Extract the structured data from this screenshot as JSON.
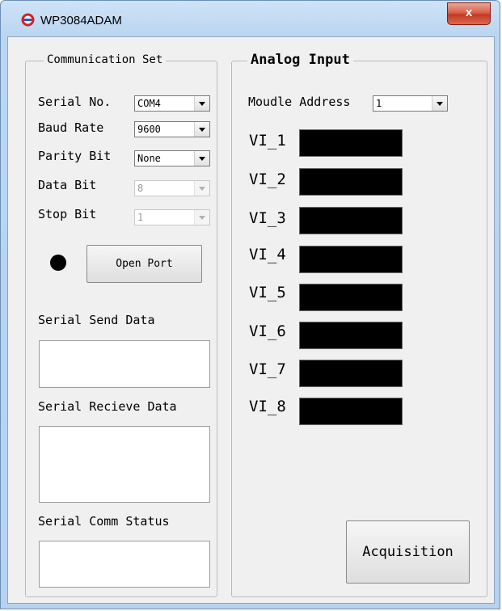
{
  "window": {
    "title": "WP3084ADAM",
    "close_label": "x"
  },
  "comm_group": {
    "legend": "Communication Set",
    "serial_no_label": "Serial No.",
    "serial_no_value": "COM4",
    "baud_rate_label": "Baud Rate",
    "baud_rate_value": "9600",
    "parity_bit_label": "Parity Bit",
    "parity_bit_value": "None",
    "data_bit_label": "Data Bit",
    "data_bit_value": "8",
    "stop_bit_label": "Stop Bit",
    "stop_bit_value": "1",
    "open_port_label": "Open Port",
    "send_data_label": "Serial Send Data",
    "send_data_value": "",
    "receive_data_label": "Serial Recieve Data",
    "receive_data_value": "",
    "comm_status_label": "Serial Comm Status",
    "comm_status_value": ""
  },
  "analog_group": {
    "legend": "Analog Input",
    "module_address_label": "Moudle Address",
    "module_address_value": "1",
    "channels": [
      {
        "label": "VI_1",
        "value": ""
      },
      {
        "label": "VI_2",
        "value": ""
      },
      {
        "label": "VI_3",
        "value": ""
      },
      {
        "label": "VI_4",
        "value": ""
      },
      {
        "label": "VI_5",
        "value": ""
      },
      {
        "label": "VI_6",
        "value": ""
      },
      {
        "label": "VI_7",
        "value": ""
      },
      {
        "label": "VI_8",
        "value": ""
      }
    ],
    "acquisition_label": "Acquisition"
  },
  "colors": {
    "led": "#000000",
    "display_bg": "#000000",
    "close_red": "#c23a24"
  },
  "icons": {
    "app": "app-logo-icon",
    "close": "close-icon"
  }
}
